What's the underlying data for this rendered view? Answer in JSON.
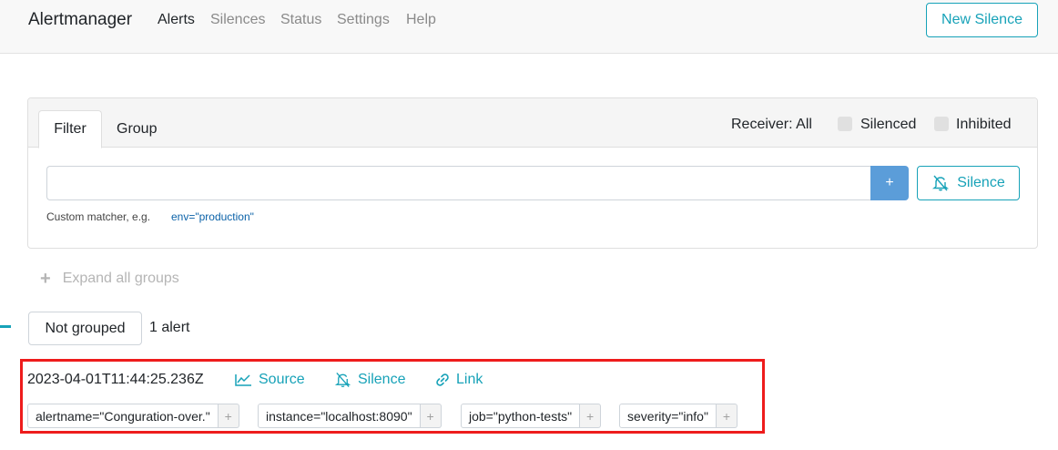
{
  "navbar": {
    "brand": "Alertmanager",
    "links": [
      "Alerts",
      "Silences",
      "Status",
      "Settings",
      "Help"
    ],
    "new_silence_label": "New Silence"
  },
  "filter": {
    "tabs": [
      "Filter",
      "Group"
    ],
    "receiver": "Receiver: All",
    "silenced_label": "Silenced",
    "inhibited_label": "Inhibited",
    "matcher_value": "",
    "add_label": "+",
    "silence_label": "Silence",
    "hint_text": "Custom matcher, e.g.",
    "hint_example": "env=\"production\""
  },
  "expand_all_label": "Expand all groups",
  "group": {
    "name": "Not grouped",
    "count": "1 alert"
  },
  "alert": {
    "timestamp": "2023-04-01T11:44:25.236Z",
    "source_label": "Source",
    "silence_label": "Silence",
    "link_label": "Link",
    "labels": [
      {
        "text": "alertname=\"Conguration-over.\"",
        "add": "+"
      },
      {
        "text": "instance=\"localhost:8090\"",
        "add": "+"
      },
      {
        "text": "job=\"python-tests\"",
        "add": "+"
      },
      {
        "text": "severity=\"info\"",
        "add": "+"
      }
    ]
  },
  "colors": {
    "accent": "#17a2b8",
    "primary_button": "#5b9dd9",
    "highlight_box": "#ee1c1c"
  }
}
